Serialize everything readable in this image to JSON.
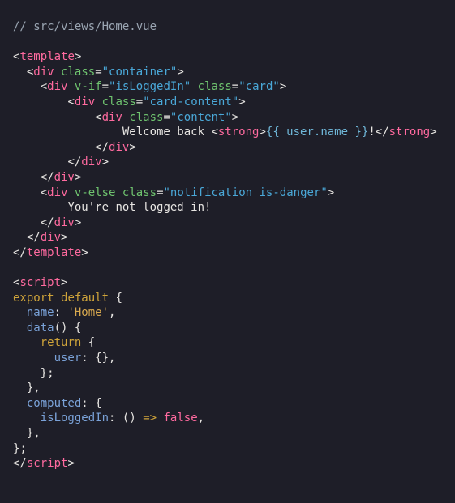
{
  "code": {
    "file_comment": "// src/views/Home.vue",
    "template_tag": "template",
    "div_tag": "div",
    "strong_tag": "strong",
    "script_tag": "script",
    "attr_class": "class",
    "attr_v_if": "v-if",
    "attr_v_else": "v-else",
    "val_container": "\"container\"",
    "val_isLoggedIn": "\"isLoggedIn\"",
    "val_card": "\"card\"",
    "val_card_content": "\"card-content\"",
    "val_content": "\"content\"",
    "val_notification": "\"notification is-danger\"",
    "txt_welcome": "Welcome back ",
    "txt_mustache": "{{ user.name }}",
    "txt_bang": "!",
    "txt_not_logged": "You're not logged in!",
    "kw_export": "export",
    "kw_default": "default",
    "kw_return": "return",
    "prop_name": "name",
    "val_home": "'Home'",
    "prop_data": "data",
    "prop_user": "user",
    "prop_computed": "computed",
    "prop_isLoggedIn": "isLoggedIn",
    "val_false": "false",
    "arrow": "=>",
    "p_open_brace": "{",
    "p_close_brace": "}",
    "p_open_paren": "(",
    "p_close_paren": ")",
    "p_open_ang": "<",
    "p_close_ang": ">",
    "p_open_ang_sl": "</",
    "p_eq": "=",
    "p_colon": ":",
    "p_comma": ",",
    "p_semi": ";",
    "p_parens": "()",
    "p_braces": "{}"
  }
}
